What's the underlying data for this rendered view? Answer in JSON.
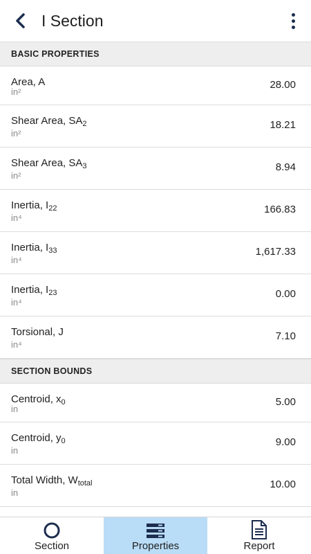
{
  "header": {
    "title": "I Section",
    "back_icon": "chevron-left-icon",
    "menu_icon": "more-vertical-icon"
  },
  "sections": [
    {
      "title": "BASIC PROPERTIES",
      "rows": [
        {
          "label": "Area, A",
          "sub": "",
          "unit": "in²",
          "value": "28.00"
        },
        {
          "label": "Shear Area, SA",
          "sub": "2",
          "unit": "in²",
          "value": "18.21"
        },
        {
          "label": "Shear Area, SA",
          "sub": "3",
          "unit": "in²",
          "value": "8.94"
        },
        {
          "label": "Inertia, I",
          "sub": "22",
          "unit": "in⁴",
          "value": "166.83"
        },
        {
          "label": "Inertia, I",
          "sub": "33",
          "unit": "in⁴",
          "value": "1,617.33"
        },
        {
          "label": "Inertia, I",
          "sub": "23",
          "unit": "in⁴",
          "value": "0.00"
        },
        {
          "label": "Torsional, J",
          "sub": "",
          "unit": "in⁴",
          "value": "7.10"
        }
      ]
    },
    {
      "title": "SECTION BOUNDS",
      "rows": [
        {
          "label": "Centroid, x",
          "sub": "0",
          "unit": "in",
          "value": "5.00"
        },
        {
          "label": "Centroid, y",
          "sub": "0",
          "unit": "in",
          "value": "9.00"
        },
        {
          "label": "Total Width, W",
          "sub": "total",
          "unit": "in",
          "value": "10.00"
        },
        {
          "label": "",
          "sub": "",
          "unit": "",
          "value": ""
        }
      ]
    }
  ],
  "bottom_nav": [
    {
      "label": "Section",
      "icon": "circle-icon",
      "active": false
    },
    {
      "label": "Properties",
      "icon": "list-icon",
      "active": true
    },
    {
      "label": "Report",
      "icon": "document-icon",
      "active": false
    }
  ],
  "colors": {
    "accent": "#1c2d4f",
    "active_tab": "#b9dcf7",
    "section_bg": "#eeeeee"
  }
}
